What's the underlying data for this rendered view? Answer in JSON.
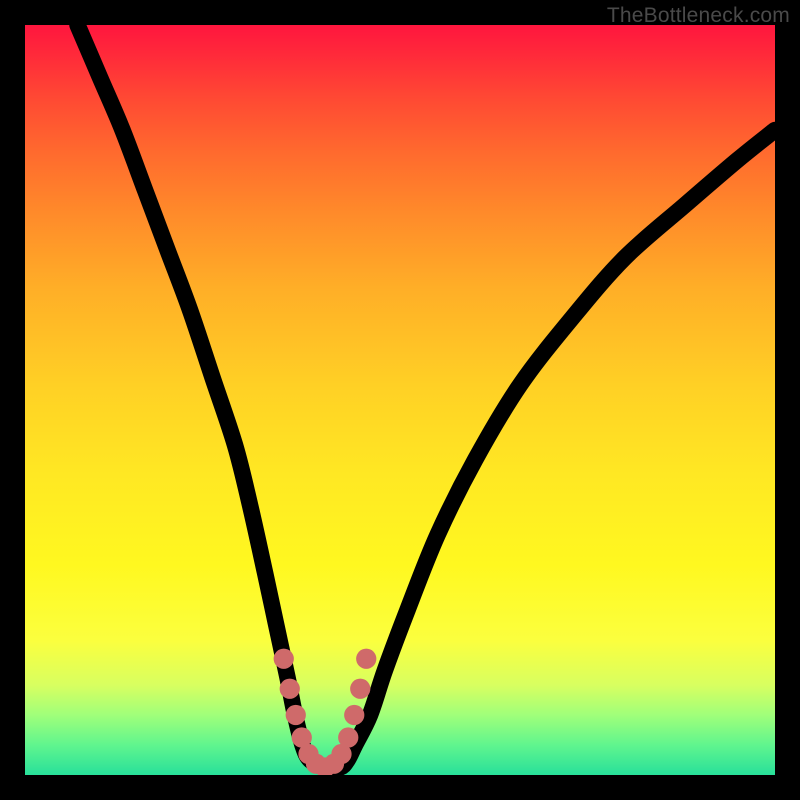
{
  "attribution": "TheBottleneck.com",
  "colors": {
    "frame": "#000000",
    "curve": "#000000",
    "dots": "#cf6a6a",
    "gradient_top": "#ff163e",
    "gradient_bottom": "#28e09a"
  },
  "chart_data": {
    "type": "line",
    "title": "",
    "xlabel": "",
    "ylabel": "",
    "xlim": [
      0,
      100
    ],
    "ylim": [
      0,
      100
    ],
    "annotations": [],
    "series": [
      {
        "name": "curve",
        "x": [
          7,
          10,
          13,
          16,
          19,
          22,
          25,
          28,
          30,
          32,
          33.5,
          35,
          36,
          37,
          38,
          40,
          42,
          43,
          44,
          46,
          48,
          51,
          55,
          60,
          66,
          73,
          80,
          88,
          95,
          100
        ],
        "y": [
          100,
          93,
          86,
          78,
          70,
          62,
          53,
          44,
          36,
          27,
          20,
          13,
          8,
          4,
          2,
          1,
          1,
          2,
          4,
          8,
          14,
          22,
          32,
          42,
          52,
          61,
          69,
          76,
          82,
          86
        ]
      },
      {
        "name": "trough-dots",
        "x": [
          34.5,
          35.3,
          36.1,
          36.9,
          37.8,
          38.8,
          40.0,
          41.2,
          42.2,
          43.1,
          43.9,
          44.7,
          45.5
        ],
        "y": [
          15.5,
          11.5,
          8.0,
          5.0,
          2.8,
          1.5,
          1.0,
          1.5,
          2.8,
          5.0,
          8.0,
          11.5,
          15.5
        ]
      }
    ]
  }
}
